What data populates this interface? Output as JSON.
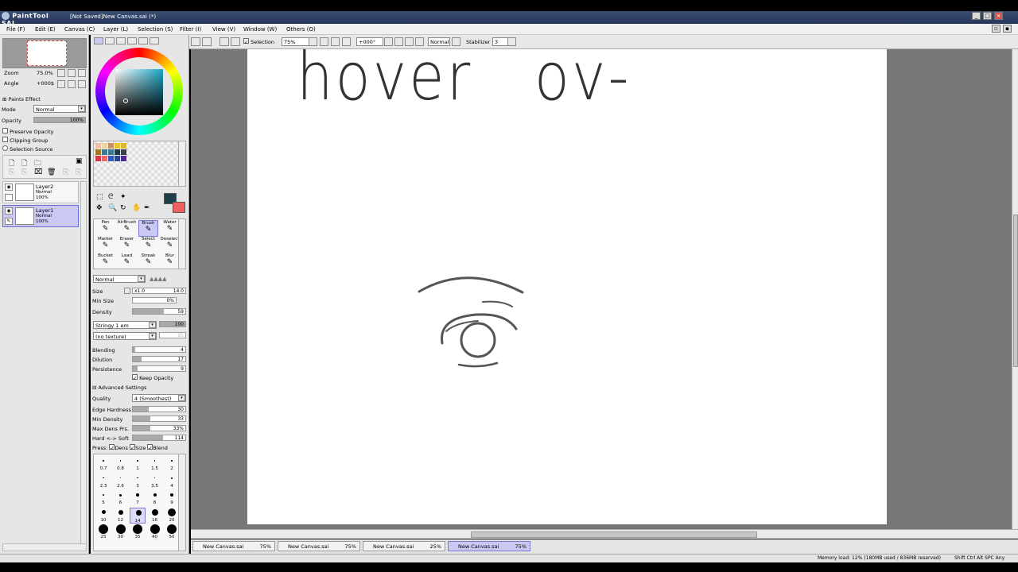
{
  "app": {
    "logo_text": "PaintTool SAI",
    "window_title": "[Not Saved]New Canvas.sai (*)"
  },
  "menu": [
    "File (F)",
    "Edit (E)",
    "Canvas (C)",
    "Layer (L)",
    "Selection (S)",
    "Filter (I)",
    "View (V)",
    "Window (W)",
    "Others (O)"
  ],
  "navigator": {
    "zoom_label": "Zoom",
    "zoom_value": "75.0%",
    "angle_label": "Angle",
    "angle_value": "+000$"
  },
  "layer_props": {
    "paints_effect": "Paints Effect",
    "mode_label": "Mode",
    "mode_value": "Normal",
    "opacity_label": "Opacity",
    "opacity_value": "100%",
    "opacity_fraction": 1.0,
    "preserve_opacity": "Preserve Opacity",
    "clipping_group": "Clipping Group",
    "selection_source": "Selection Source"
  },
  "layers": [
    {
      "name": "Layer2",
      "mode": "Normal",
      "opacity": "100%",
      "selected": false
    },
    {
      "name": "Layer1",
      "mode": "Normal",
      "opacity": "100%",
      "selected": true
    }
  ],
  "swatches": [
    "#f2c0a8",
    "#e8d7a0",
    "#c89068",
    "#e8c830",
    "#d8b830",
    "#a07828",
    "#3c7898",
    "#407890",
    "#203848",
    "#3a4048",
    "#d03848",
    "#e86868",
    "#3858b8",
    "#284890",
    "#502890"
  ],
  "colors": {
    "primary": "#1e4048",
    "secondary": "#f06060"
  },
  "tools": {
    "row1": [
      "Pen",
      "AirBrush",
      "Brush",
      "Water"
    ],
    "row2": [
      "Marker",
      "Eraser",
      "Select",
      "Deselect"
    ],
    "row3": [
      "Bucket",
      "Lead",
      "Streak",
      "Blur"
    ],
    "active": "Brush"
  },
  "brush": {
    "blend_mode": "Normal",
    "size_label": "Size",
    "size_mult": "x1.0",
    "size_value": "14.0",
    "min_size_label": "Min Size",
    "min_size_value": "0%",
    "density_label": "Density",
    "density_value": "59",
    "density_fraction": 0.59,
    "shape_value": "Stringy 1 em",
    "shape_amount": "100",
    "texture_value": "(no texture)",
    "texture_amount": "95",
    "blending_label": "Blending",
    "blending_value": "4",
    "blending_fraction": 0.04,
    "dilution_label": "Dilution",
    "dilution_value": "17",
    "dilution_fraction": 0.17,
    "persistence_label": "Persistence",
    "persistence_value": "9",
    "persistence_fraction": 0.09,
    "keep_opacity": "Keep Opacity",
    "advanced_label": "Advanced Settings",
    "quality_label": "Quality",
    "quality_value": "4 (Smoothest)",
    "edge_hardness_label": "Edge Hardness",
    "edge_hardness_value": "30",
    "edge_hardness_fraction": 0.3,
    "min_density_label": "Min Density",
    "min_density_value": "33",
    "min_density_fraction": 0.33,
    "max_dens_label": "Max Dens Prs.",
    "max_dens_value": "33%",
    "max_dens_fraction": 0.33,
    "hard_soft_label": "Hard <-> Soft",
    "hard_soft_value": "114",
    "hard_soft_fraction": 0.57,
    "press_label": "Press:",
    "press_dens": "Dens",
    "press_size": "Size",
    "press_blend": "Blend"
  },
  "brush_sizes": [
    "0.7",
    "0.8",
    "1",
    "1.5",
    "2",
    "2.3",
    "2.6",
    "3",
    "3.5",
    "4",
    "5",
    "6",
    "7",
    "8",
    "9",
    "10",
    "12",
    "14",
    "16",
    "20",
    "25",
    "30",
    "35",
    "40",
    "50"
  ],
  "toolbar": {
    "selection_label": "Selection",
    "zoom_value": "75%",
    "angle_value": "+000°",
    "mode_value": "Normal",
    "stabilizer_label": "Stabilizer",
    "stabilizer_value": "3"
  },
  "canvas_text": "hover   ov-",
  "tabs": [
    {
      "name": "New Canvas.sai",
      "zoom": "75%"
    },
    {
      "name": "New Canvas.sai",
      "zoom": "75%"
    },
    {
      "name": "New Canvas.sai",
      "zoom": "25%"
    },
    {
      "name": "New Canvas.sai",
      "zoom": "75%"
    }
  ],
  "status": {
    "memory": "Memory load: 12% (180MB used / 836MB reserved)",
    "keys": "Shift Ctrl Alt SPC Any"
  }
}
